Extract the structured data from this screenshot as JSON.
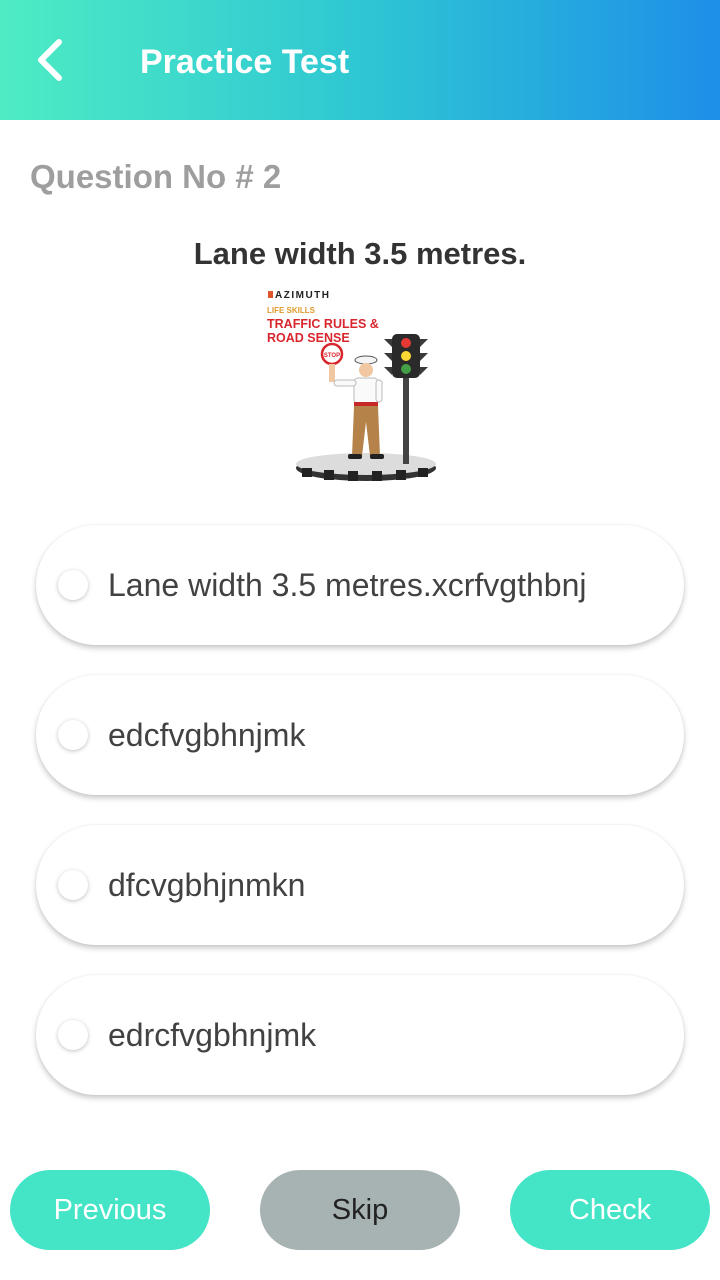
{
  "header": {
    "back_icon": "chevron-left-icon",
    "title": "Practice Test",
    "gradient": [
      "#4eecc4",
      "#1e8fe8"
    ]
  },
  "question": {
    "number_label": "Question No # 2",
    "text": "Lane width 3.5 metres.",
    "image": {
      "brand": "AZIMUTH",
      "subtitle": "LIFE SKILLS",
      "title_line1": "TRAFFIC RULES &",
      "title_line2": "ROAD SENSE",
      "sign_text": "STOP"
    }
  },
  "options": [
    {
      "label": "Lane width 3.5 metres.xcrfvgthbnj",
      "selected": false
    },
    {
      "label": "edcfvgbhnjmk",
      "selected": false
    },
    {
      "label": "dfcvgbhjnmkn",
      "selected": false
    },
    {
      "label": "edrcfvgbhnjmk",
      "selected": false
    }
  ],
  "footer": {
    "previous_label": "Previous",
    "skip_label": "Skip",
    "check_label": "Check",
    "accent_color": "#44e4c6",
    "skip_color": "#a7b2b2"
  }
}
